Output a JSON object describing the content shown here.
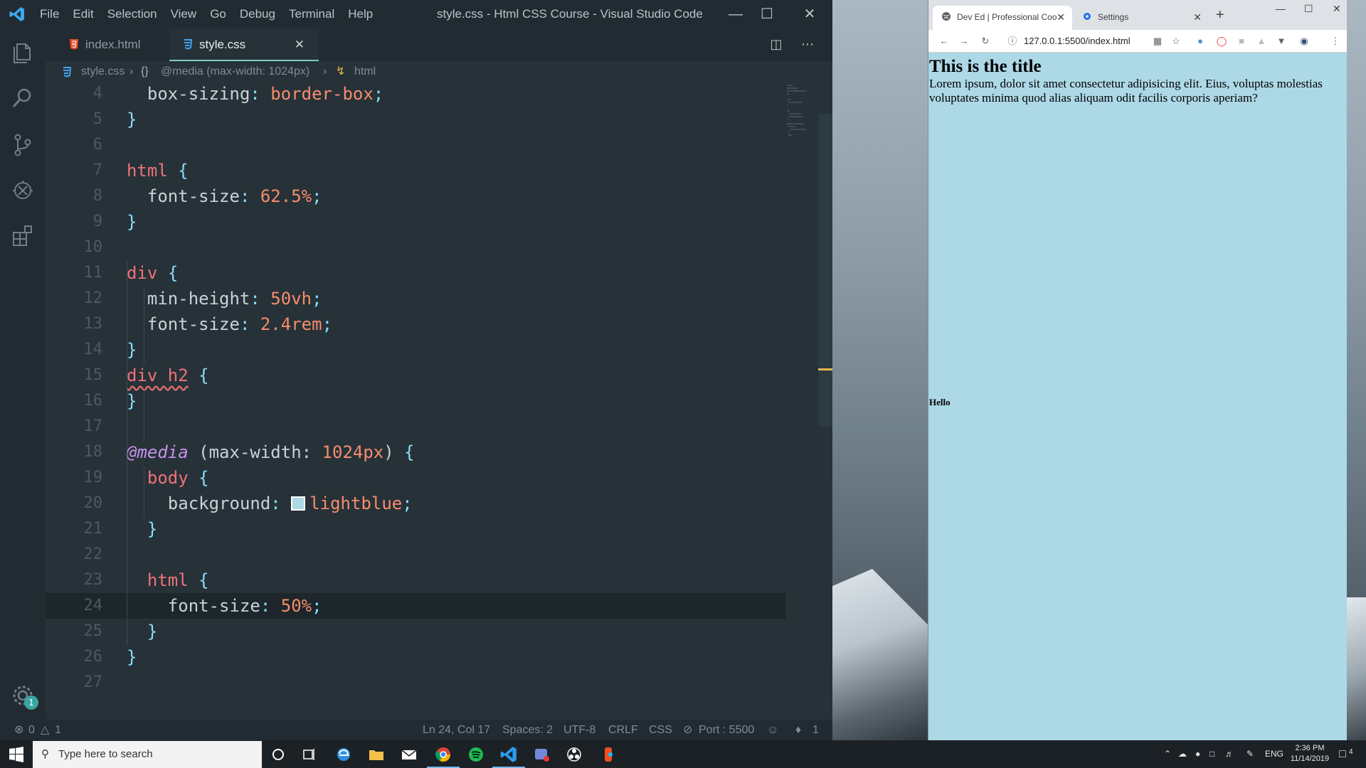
{
  "vscode": {
    "menu": [
      "File",
      "Edit",
      "Selection",
      "View",
      "Go",
      "Debug",
      "Terminal",
      "Help"
    ],
    "window_title": "style.css - Html CSS Course - Visual Studio Code",
    "tabs": [
      {
        "label": "index.html",
        "active": false
      },
      {
        "label": "style.css",
        "active": true
      }
    ],
    "breadcrumb": {
      "file": "style.css",
      "media": "@media (max-width: 1024px)",
      "rule": "html"
    },
    "lines": [
      {
        "n": "4",
        "tokens": [
          [
            "prop",
            "  box-sizing"
          ],
          [
            "punc",
            ": "
          ],
          [
            "val",
            "border-box"
          ],
          [
            "punc",
            ";"
          ]
        ]
      },
      {
        "n": "5",
        "tokens": [
          [
            "brace",
            "}"
          ]
        ]
      },
      {
        "n": "6",
        "tokens": []
      },
      {
        "n": "7",
        "tokens": [
          [
            "sel",
            "html"
          ],
          [
            "plain",
            " "
          ],
          [
            "brace",
            "{"
          ]
        ]
      },
      {
        "n": "8",
        "tokens": [
          [
            "prop",
            "  font-size"
          ],
          [
            "punc",
            ": "
          ],
          [
            "val",
            "62.5%"
          ],
          [
            "punc",
            ";"
          ]
        ]
      },
      {
        "n": "9",
        "tokens": [
          [
            "brace",
            "}"
          ]
        ]
      },
      {
        "n": "10",
        "tokens": []
      },
      {
        "n": "11",
        "tokens": [
          [
            "sel",
            "div"
          ],
          [
            "plain",
            " "
          ],
          [
            "brace",
            "{"
          ]
        ]
      },
      {
        "n": "12",
        "tokens": [
          [
            "prop",
            "  min-height"
          ],
          [
            "punc",
            ": "
          ],
          [
            "val",
            "50vh"
          ],
          [
            "punc",
            ";"
          ]
        ]
      },
      {
        "n": "13",
        "tokens": [
          [
            "prop",
            "  font-size"
          ],
          [
            "punc",
            ": "
          ],
          [
            "val",
            "2.4rem"
          ],
          [
            "punc",
            ";"
          ]
        ]
      },
      {
        "n": "14",
        "tokens": [
          [
            "brace",
            "}"
          ]
        ]
      },
      {
        "n": "15",
        "tokens": [
          [
            "selsq",
            "div h2"
          ],
          [
            "plain",
            " "
          ],
          [
            "brace",
            "{"
          ]
        ]
      },
      {
        "n": "16",
        "tokens": [
          [
            "brace",
            "}"
          ]
        ]
      },
      {
        "n": "17",
        "tokens": []
      },
      {
        "n": "18",
        "tokens": [
          [
            "at",
            "@media"
          ],
          [
            "plain",
            " (max-width: "
          ],
          [
            "val",
            "1024px"
          ],
          [
            "plain",
            ") "
          ],
          [
            "brace",
            "{"
          ]
        ]
      },
      {
        "n": "19",
        "tokens": [
          [
            "sel",
            "  body"
          ],
          [
            "plain",
            " "
          ],
          [
            "brace",
            "{"
          ]
        ]
      },
      {
        "n": "20",
        "tokens": [
          [
            "prop",
            "    background"
          ],
          [
            "punc",
            ": "
          ],
          [
            "swatch",
            ""
          ],
          [
            "val",
            "lightblue"
          ],
          [
            "punc",
            ";"
          ]
        ]
      },
      {
        "n": "21",
        "tokens": [
          [
            "brace",
            "  }"
          ]
        ]
      },
      {
        "n": "22",
        "tokens": []
      },
      {
        "n": "23",
        "tokens": [
          [
            "sel",
            "  html"
          ],
          [
            "plain",
            " "
          ],
          [
            "brace",
            "{"
          ]
        ]
      },
      {
        "n": "24",
        "tokens": [
          [
            "prop",
            "    font-size"
          ],
          [
            "punc",
            ": "
          ],
          [
            "val",
            "50%"
          ],
          [
            "punc",
            ";"
          ]
        ],
        "current": true
      },
      {
        "n": "25",
        "tokens": [
          [
            "brace",
            "  }"
          ]
        ]
      },
      {
        "n": "26",
        "tokens": [
          [
            "brace",
            "}"
          ]
        ]
      },
      {
        "n": "27",
        "tokens": []
      }
    ],
    "status": {
      "errors": "0",
      "warnings": "1",
      "position": "Ln 24, Col 17",
      "spaces": "Spaces: 2",
      "encoding": "UTF-8",
      "eol": "CRLF",
      "language": "CSS",
      "port": "Port : 5500",
      "notifications": "1"
    },
    "settings_badge": "1"
  },
  "browser": {
    "tabs": [
      {
        "label": "Dev Ed | Professional Coo",
        "active": true
      },
      {
        "label": "Settings",
        "active": false
      }
    ],
    "url": "127.0.0.1:5500/index.html",
    "page": {
      "title": "This is the title",
      "paragraph": "Lorem ipsum, dolor sit amet consectetur adipisicing elit. Eius, voluptas molestias voluptates minima quod alias aliquam odit facilis corporis aperiam?",
      "hello": "Hello"
    }
  },
  "taskbar": {
    "search_placeholder": "Type here to search",
    "language": "ENG",
    "time": "2:36 PM",
    "date": "11/14/2019",
    "notif_count": "4"
  }
}
